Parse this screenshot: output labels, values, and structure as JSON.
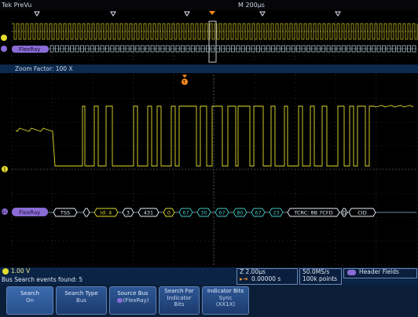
{
  "header": {
    "mode_label": "Tek PreVu",
    "timebase": "M 200µs"
  },
  "overview": {
    "bus_label": "FlexRay"
  },
  "zoom": {
    "label": "Zoom Factor: 100 X"
  },
  "main": {
    "bus_label": "FlexRay",
    "channel_marker": "1",
    "bus_marker": "B1",
    "trigger_marker": "T",
    "packets": [
      {
        "text": "TSS",
        "kind": "white"
      },
      {
        "text": "",
        "kind": "white"
      },
      {
        "text": "Id: 4",
        "kind": "yellow"
      },
      {
        "text": "3",
        "kind": "white"
      },
      {
        "text": "431",
        "kind": "white"
      },
      {
        "text": "0",
        "kind": "yellow"
      },
      {
        "text": "67",
        "kind": "cyan"
      },
      {
        "text": "30",
        "kind": "cyan"
      },
      {
        "text": "67",
        "kind": "cyan"
      },
      {
        "text": "80",
        "kind": "cyan"
      },
      {
        "text": "67",
        "kind": "cyan"
      },
      {
        "text": "23",
        "kind": "cyan"
      },
      {
        "text": "TCRC: 8B 7CFD",
        "kind": "white"
      },
      {
        "text": "D",
        "kind": "white"
      },
      {
        "text": "CID",
        "kind": "white"
      }
    ]
  },
  "status": {
    "ch1_scale": "1.00 V",
    "events_found": "Bus Search events found: 5",
    "horiz_scale": "Z 2.00µs",
    "trig_pos": "0.00000 s",
    "sample_rate": "50.0MS/s",
    "record_len": "100k points",
    "bus_trigger": "Header Fields"
  },
  "menu": {
    "buttons": [
      {
        "line1": "Search",
        "line2": "On"
      },
      {
        "line1": "Search Type",
        "line2": "Bus"
      },
      {
        "line1": "Source Bus",
        "line2": "(FlexRay)"
      },
      {
        "line1": "Search For",
        "line2": "Indicator",
        "line3": "Bits"
      },
      {
        "line1": "Indicator Bits",
        "line2": "Sync",
        "line3": "(XX1X)"
      }
    ]
  },
  "colors": {
    "ch1": "#e4dc2c",
    "bus_packet_cyan": "#3fc8c8",
    "bus_label_purple": "#8a6cd6",
    "trigger_orange": "#ff8a1c",
    "grid": "#454a57"
  }
}
